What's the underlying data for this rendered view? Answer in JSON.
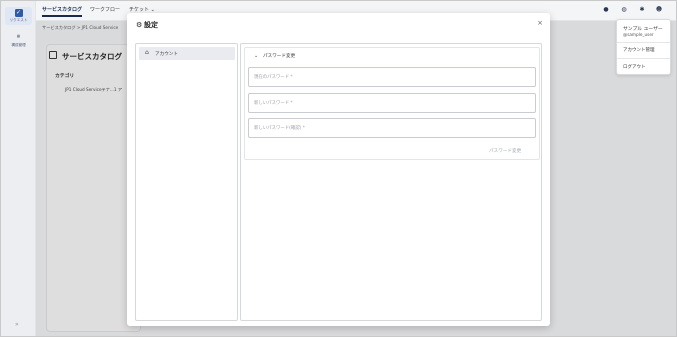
{
  "rail": {
    "items": [
      {
        "label": "リクエスト",
        "icon": "check-square-icon"
      },
      {
        "label": "構成管理",
        "icon": "grid-icon"
      }
    ],
    "bottom_icon": "chevron-right-icon"
  },
  "topbar": {
    "tabs": [
      "サービスカタログ",
      "ワークフロー",
      "チケット ⌄"
    ],
    "icons": [
      "chat-icon",
      "help-icon",
      "gear-icon",
      "user-icon"
    ]
  },
  "background": {
    "breadcrumb": "サービスカタログ > JP1 Cloud Service",
    "title": "サービスカタログ",
    "category_label": "カテゴリ",
    "category_item": "JP1 Cloud Serviceテナ...1 ア"
  },
  "user_menu": {
    "name": "サンプル ユーザー",
    "id": "@sample_user",
    "account_link": "アカウント管理",
    "logout": "ログアウト"
  },
  "modal": {
    "title": "設定",
    "close": "×",
    "nav": [
      {
        "label": "アカウント",
        "icon": "account-icon"
      }
    ],
    "section_title": "パスワード変更",
    "fields": [
      {
        "placeholder": "現在のパスワード *",
        "value": ""
      },
      {
        "placeholder": "新しいパスワード *",
        "value": ""
      },
      {
        "placeholder": "新しいパスワード(確認) *",
        "value": ""
      }
    ],
    "submit_label": "パスワード変更"
  },
  "colors": {
    "accent": "#2f5aa8",
    "nav_active_bg": "#e9ebf0",
    "overlay": "#00000020"
  }
}
